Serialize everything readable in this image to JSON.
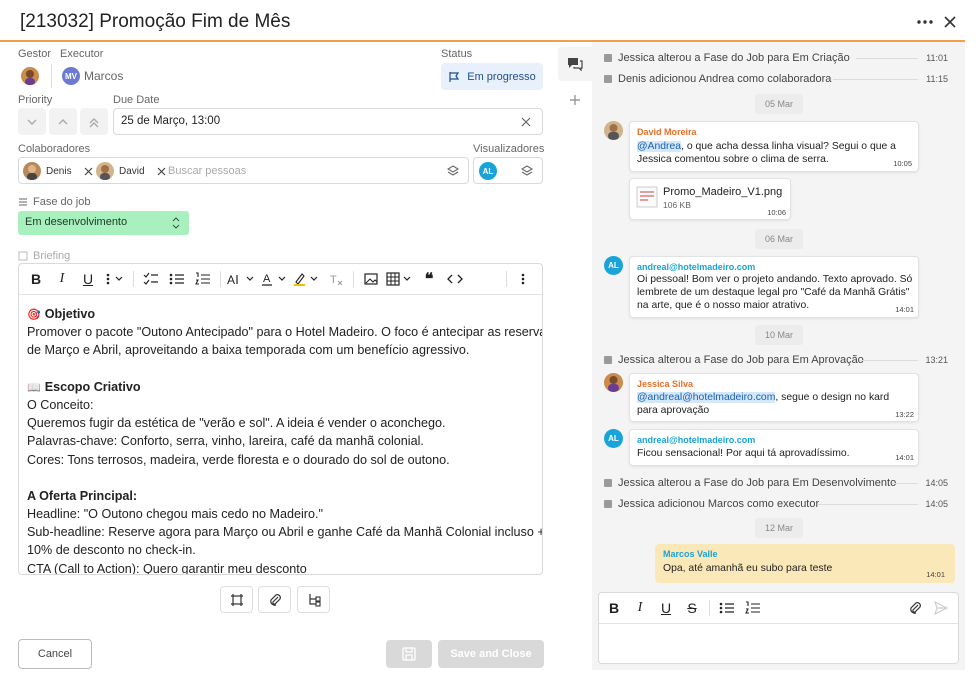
{
  "header": {
    "title": "[213032] Promoção Fim de Mês",
    "more_icon": "more-horizontal-icon",
    "close_icon": "close-icon"
  },
  "fields": {
    "gestor_label": "Gestor",
    "executor_label": "Executor",
    "executor_initials": "MV",
    "executor_name": "Marcos",
    "status_label": "Status",
    "status_value": "Em progresso",
    "priority_label": "Priority",
    "due_label": "Due Date",
    "due_value": "25 de Março, 13:00",
    "colab_label": "Colaboradores",
    "colab": [
      {
        "name": "Denis"
      },
      {
        "name": "David"
      }
    ],
    "colab_placeholder": "Buscar pessoas",
    "viewers_label": "Visualizadores",
    "viewer_initials": "AL",
    "phase_label": "Fase do job",
    "phase_value": "Em desenvolvimento",
    "briefing_label": "Briefing"
  },
  "editor": {
    "lines": [
      {
        "icon": "🎯",
        "bold": "Objetivo",
        "text": ""
      },
      {
        "bold": "",
        "text": "Promover o pacote \"Outono Antecipado\" para o Hotel Madeiro. O foco é antecipar as reservas"
      },
      {
        "bold": "",
        "text": "de Março e Abril, aproveitando a baixa temporada com um benefício agressivo."
      },
      {
        "bold": "",
        "text": ""
      },
      {
        "icon": "📖",
        "bold": "Escopo Criativo",
        "text": ""
      },
      {
        "bold": "",
        "text": "O Conceito:"
      },
      {
        "bold": "",
        "text": "Queremos fugir da estética de \"verão e sol\". A ideia é vender o aconchego."
      },
      {
        "bold": "",
        "text": "Palavras-chave: Conforto, serra, vinho, lareira, café da manhã colonial."
      },
      {
        "bold": "",
        "text": "Cores: Tons terrosos, madeira, verde floresta e o dourado do sol de outono."
      },
      {
        "bold": "",
        "text": ""
      },
      {
        "bold": "A Oferta Principal:",
        "text": ""
      },
      {
        "bold": "",
        "text": "Headline: \"O Outono chegou mais cedo no Madeiro.\""
      },
      {
        "bold": "",
        "text": "Sub-headline: Reserve agora para Março ou Abril e ganhe Café da Manhã Colonial incluso +"
      },
      {
        "bold": "",
        "text": "10% de desconto no check-in."
      },
      {
        "bold": "",
        "text": "CTA (Call to Action): Quero garantir meu desconto"
      }
    ]
  },
  "footer": {
    "cancel": "Cancel",
    "save_close": "Save and Close"
  },
  "activity": {
    "events_top": [
      {
        "text": "Jessica alterou a Fase do Job para Em Criação",
        "time": "11:01"
      },
      {
        "text": "Denis adicionou Andrea como colaboradora",
        "time": "11:15"
      }
    ],
    "date1": "05 Mar",
    "msg1": {
      "name": "David Moreira",
      "mention": "@Andrea",
      "text": ", o que acha dessa linha visual? Segui o que a Jessica comentou sobre o clima de serra.",
      "time": "10:05"
    },
    "file": {
      "name": "Promo_Madeiro_V1.png",
      "size": "106 KB",
      "time": "10:06"
    },
    "date2": "06 Mar",
    "msg2": {
      "initials": "AL",
      "name": "andreal@hotelmadeiro.com",
      "text": "Oi pessoal! Bom ver o projeto andando. Texto aprovado. Só lembrete de um destaque legal pro \"Café da Manhã Grátis\" na arte, que é o nosso maior atrativo.",
      "time": "14:01"
    },
    "date3": "10 Mar",
    "event_mid": {
      "text": "Jessica alterou a Fase do Job para Em Aprovação",
      "time": "13:21"
    },
    "msg3": {
      "name": "Jessica Silva",
      "mention": "@andreal@hotelmadeiro.com",
      "text": ", segue o design no kard para aprovação",
      "time": "13:22"
    },
    "msg4": {
      "initials": "AL",
      "name": "andreal@hotelmadeiro.com",
      "text": "Ficou sensacional! Por aqui tá aprovadíssimo.",
      "time": "14:01"
    },
    "events_bottom": [
      {
        "text": "Jessica alterou a Fase do Job para Em Desenvolvimento",
        "time": "14:05"
      },
      {
        "text": "Jessica adicionou Marcos como executor",
        "time": "14:05"
      }
    ],
    "date4": "12 Mar",
    "msg5": {
      "name": "Marcos Valle",
      "text": "Opa, até amanhã eu subo para teste",
      "time": "14:01"
    }
  },
  "colors": {
    "accent": "#f0a04b",
    "status_bg": "#e8f0fb",
    "phase_bg": "#a8f0bd",
    "self_bubble": "#fbe8b8",
    "name_orange": "#e8702a",
    "name_blue": "#1aa3d9"
  }
}
